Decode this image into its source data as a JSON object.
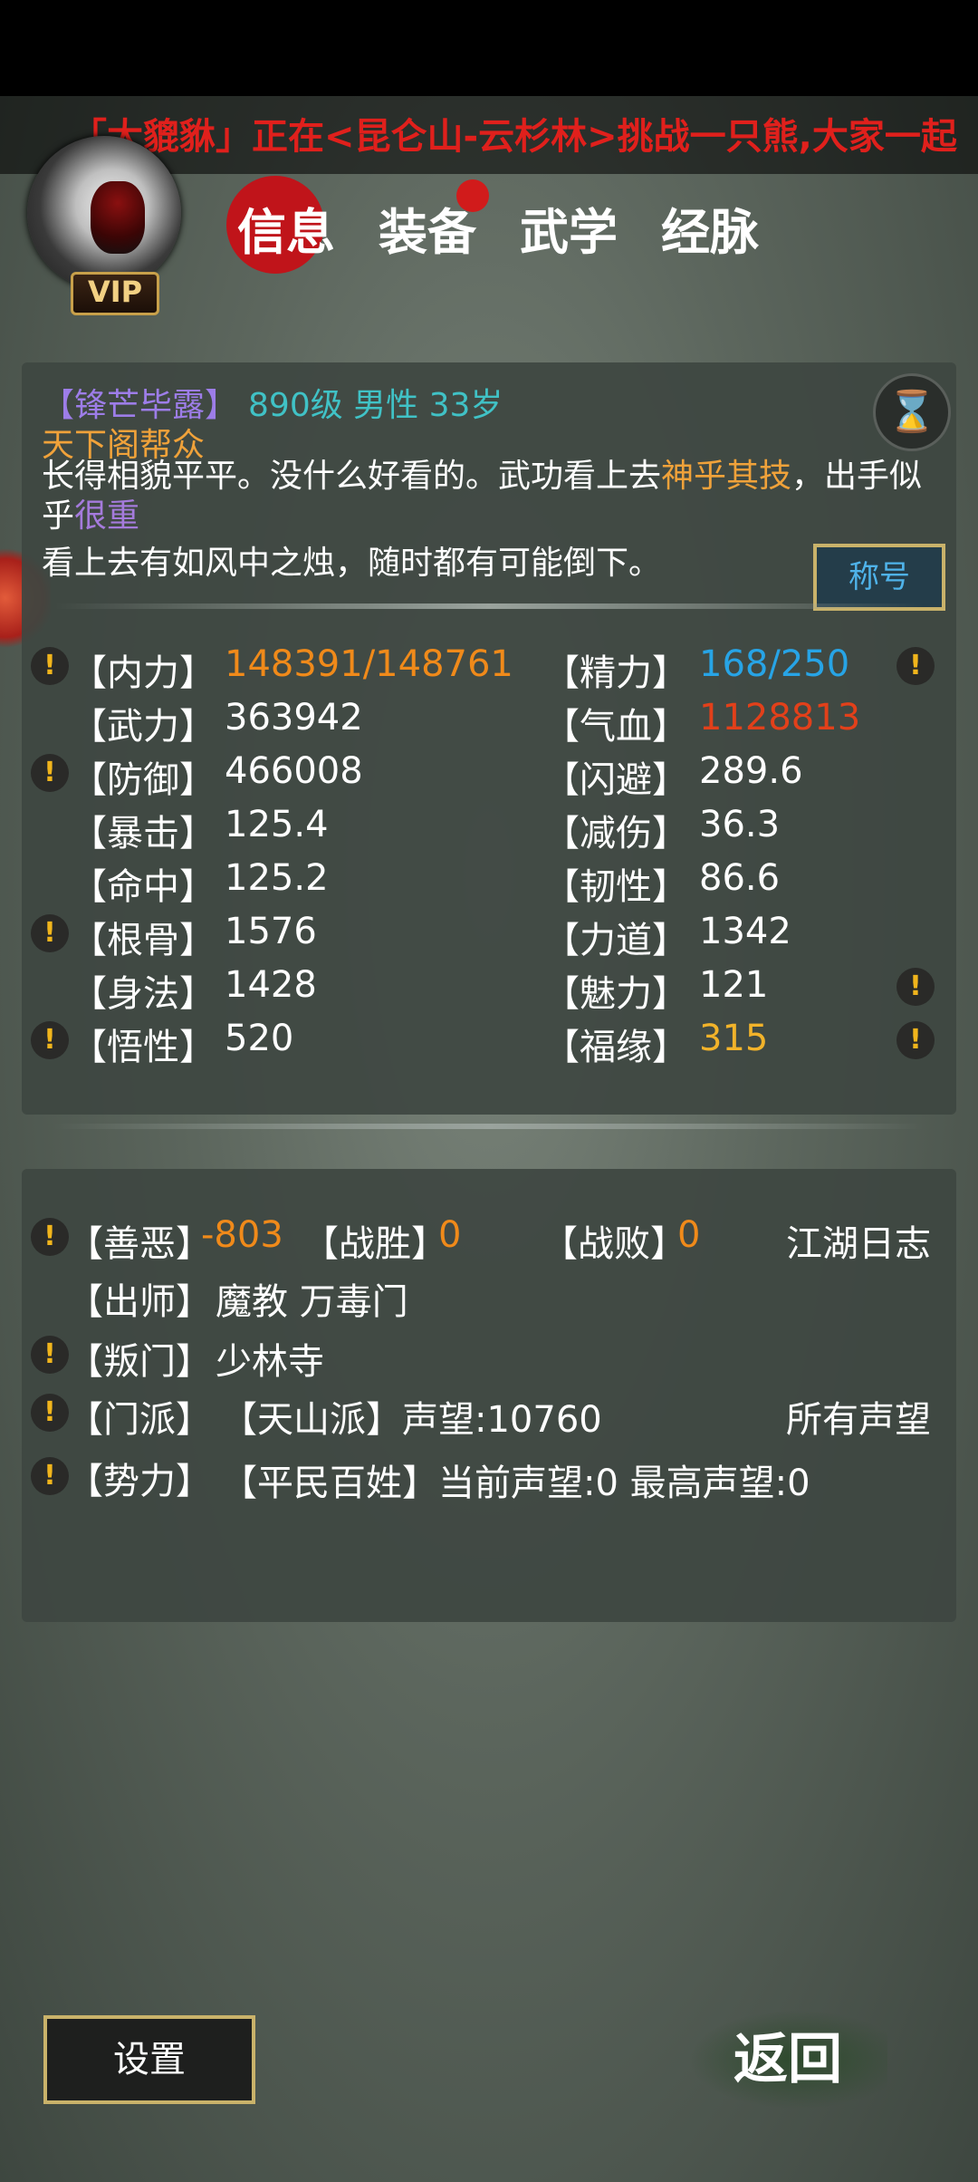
{
  "marquee": "「大貔貅」正在<昆仑山-云杉林>挑战一只熊,大家一起",
  "avatar": {
    "vip_label": "VIP"
  },
  "tabs": [
    "信息",
    "装备",
    "武学",
    "经脉"
  ],
  "profile": {
    "name": "【锋芒毕露】",
    "level_info": "890级 男性 33岁",
    "sect": "天下阁帮众",
    "desc_a": "长得相貌平平。没什么好看的。武功看上去",
    "desc_b": "神乎其技",
    "desc_c": "，出手似乎",
    "desc_d": "很重",
    "desc_line3": "看上去有如风中之烛，随时都有可能倒下。",
    "title_button": "称号"
  },
  "stats_left": [
    {
      "label": "【内力】",
      "value": "148391/148761",
      "warn": true,
      "color": "#f08a1a"
    },
    {
      "label": "【武力】",
      "value": "363942",
      "warn": false,
      "color": "#ffffff"
    },
    {
      "label": "【防御】",
      "value": "466008",
      "warn": true,
      "color": "#ffffff"
    },
    {
      "label": "【暴击】",
      "value": "125.4",
      "warn": false,
      "color": "#ffffff"
    },
    {
      "label": "【命中】",
      "value": "125.2",
      "warn": false,
      "color": "#ffffff"
    },
    {
      "label": "【根骨】",
      "value": "1576",
      "warn": true,
      "color": "#ffffff"
    },
    {
      "label": "【身法】",
      "value": "1428",
      "warn": false,
      "color": "#ffffff"
    },
    {
      "label": "【悟性】",
      "value": "520",
      "warn": true,
      "color": "#ffffff"
    }
  ],
  "stats_right": [
    {
      "label": "【精力】",
      "value": "168/250",
      "warn": true,
      "color": "#27a4e6"
    },
    {
      "label": "【气血】",
      "value": "1128813",
      "warn": false,
      "color": "#e2401a"
    },
    {
      "label": "【闪避】",
      "value": "289.6",
      "warn": false,
      "color": "#ffffff"
    },
    {
      "label": "【减伤】",
      "value": "36.3",
      "warn": false,
      "color": "#ffffff"
    },
    {
      "label": "【韧性】",
      "value": "86.6",
      "warn": false,
      "color": "#ffffff"
    },
    {
      "label": "【力道】",
      "value": "1342",
      "warn": false,
      "color": "#ffffff"
    },
    {
      "label": "【魅力】",
      "value": "121",
      "warn": true,
      "color": "#ffffff"
    },
    {
      "label": "【福缘】",
      "value": "315",
      "warn": true,
      "color": "#f2b32a"
    }
  ],
  "jianghu": {
    "good_evil_label": "【善恶】",
    "good_evil_value": "-803",
    "wins_label": "【战胜】",
    "wins_value": "0",
    "losses_label": "【战败】",
    "losses_value": "0",
    "log_link": "江湖日志",
    "master_label": "【出师】",
    "master_value": "魔教 万毒门",
    "traitor_label": "【叛门】",
    "traitor_value": "少林寺",
    "school_label": "【门派】",
    "school_value": "【天山派】声望:10760",
    "all_fame_link": "所有声望",
    "faction_label": "【势力】",
    "faction_value": "【平民百姓】当前声望:0 最高声望:0"
  },
  "buttons": {
    "settings": "设置",
    "back": "返回"
  }
}
